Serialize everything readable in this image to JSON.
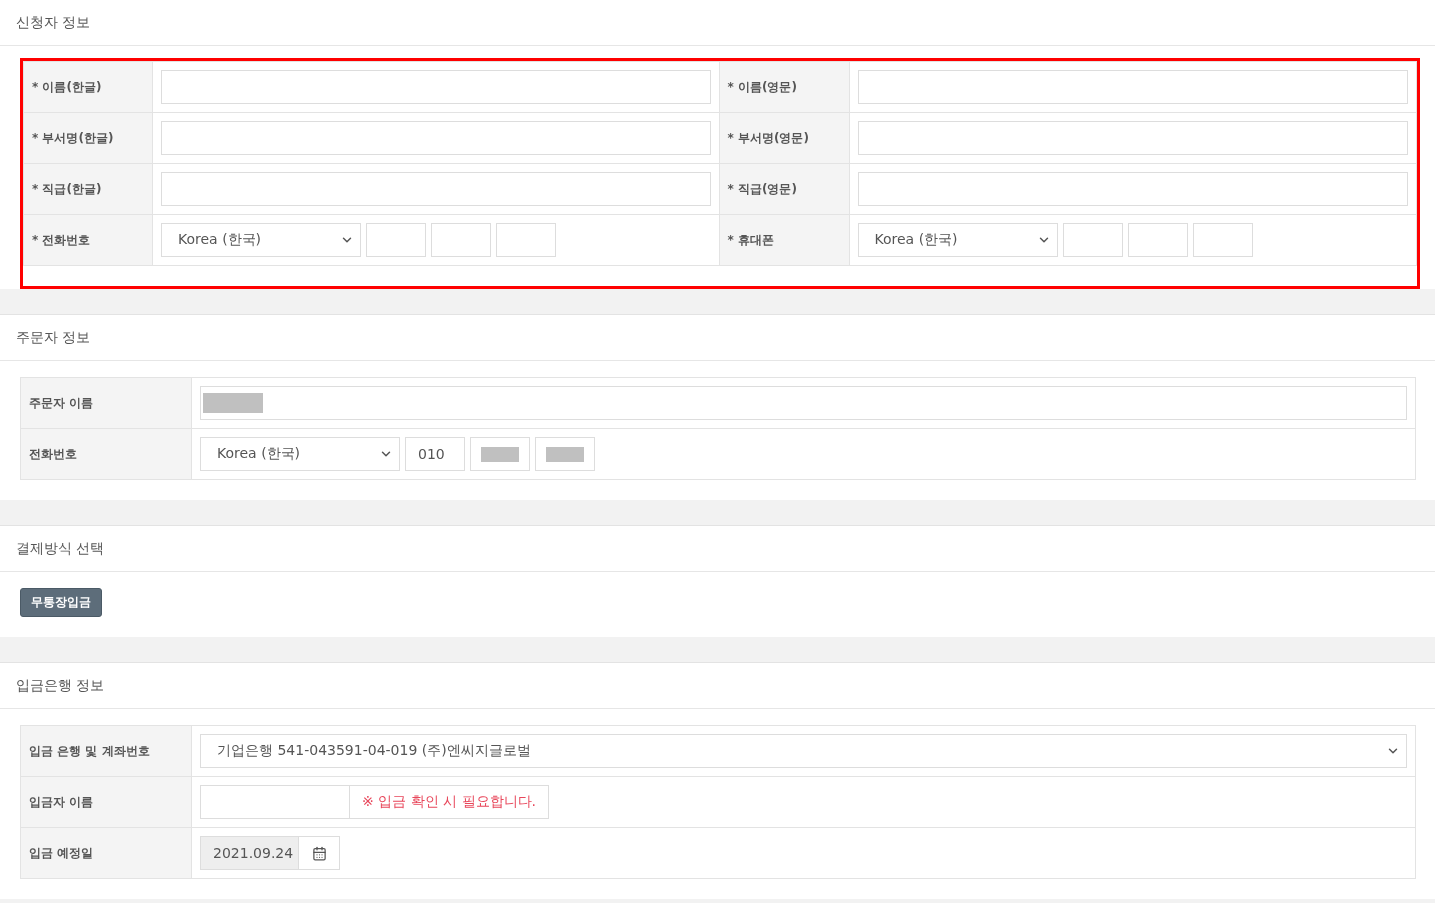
{
  "sections": [
    {
      "title": "신청자 정보",
      "kind": "table",
      "highlighted": true,
      "rows": [
        {
          "cells": [
            {
              "label": "* 이름(한글)",
              "control": {
                "kind": "text"
              }
            },
            {
              "label": "* 이름(영문)",
              "control": {
                "kind": "text"
              }
            }
          ]
        },
        {
          "cells": [
            {
              "label": "* 부서명(한글)",
              "control": {
                "kind": "text"
              }
            },
            {
              "label": "* 부서명(영문)",
              "control": {
                "kind": "text"
              }
            }
          ]
        },
        {
          "cells": [
            {
              "label": "* 직급(한글)",
              "control": {
                "kind": "text"
              }
            },
            {
              "label": "* 직급(영문)",
              "control": {
                "kind": "text"
              }
            }
          ]
        },
        {
          "cells": [
            {
              "label": "* 전화번호",
              "control": {
                "kind": "phone",
                "country": "Korea (한국)",
                "parts": [
                  {
                    "redacted": false
                  },
                  {
                    "redacted": false
                  },
                  {
                    "redacted": false
                  }
                ]
              }
            },
            {
              "label": "* 휴대폰",
              "control": {
                "kind": "phone",
                "country": "Korea (한국)",
                "parts": [
                  {
                    "redacted": false
                  },
                  {
                    "redacted": false
                  },
                  {
                    "redacted": false
                  }
                ]
              }
            }
          ]
        }
      ]
    },
    {
      "title": "주문자 정보",
      "kind": "table",
      "highlighted": false,
      "rows": [
        {
          "cells": [
            {
              "label": "주문자 이름",
              "control": {
                "kind": "text",
                "redacted": true
              }
            }
          ]
        },
        {
          "cells": [
            {
              "label": "전화번호",
              "control": {
                "kind": "phone",
                "country": "Korea (한국)",
                "parts": [
                  {
                    "value": "010",
                    "redacted": false
                  },
                  {
                    "redacted": true
                  },
                  {
                    "redacted": true
                  }
                ]
              }
            }
          ]
        }
      ]
    },
    {
      "title": "결제방식 선택",
      "kind": "buttons",
      "highlighted": false,
      "buttons": [
        "무통장입금"
      ]
    },
    {
      "title": "입금은행 정보",
      "kind": "table",
      "highlighted": false,
      "rows": [
        {
          "cells": [
            {
              "label": "입금 은행 및 계좌번호",
              "control": {
                "kind": "select",
                "value": "기업은행 541-043591-04-019 (주)엔씨지글로벌"
              }
            }
          ]
        },
        {
          "cells": [
            {
              "label": "입금자 이름",
              "control": {
                "kind": "input_note",
                "note": "※ 입금 확인 시 필요합니다."
              }
            }
          ]
        },
        {
          "cells": [
            {
              "label": "입금 예정일",
              "control": {
                "kind": "date",
                "value": "2021.09.24"
              }
            }
          ]
        }
      ]
    }
  ]
}
